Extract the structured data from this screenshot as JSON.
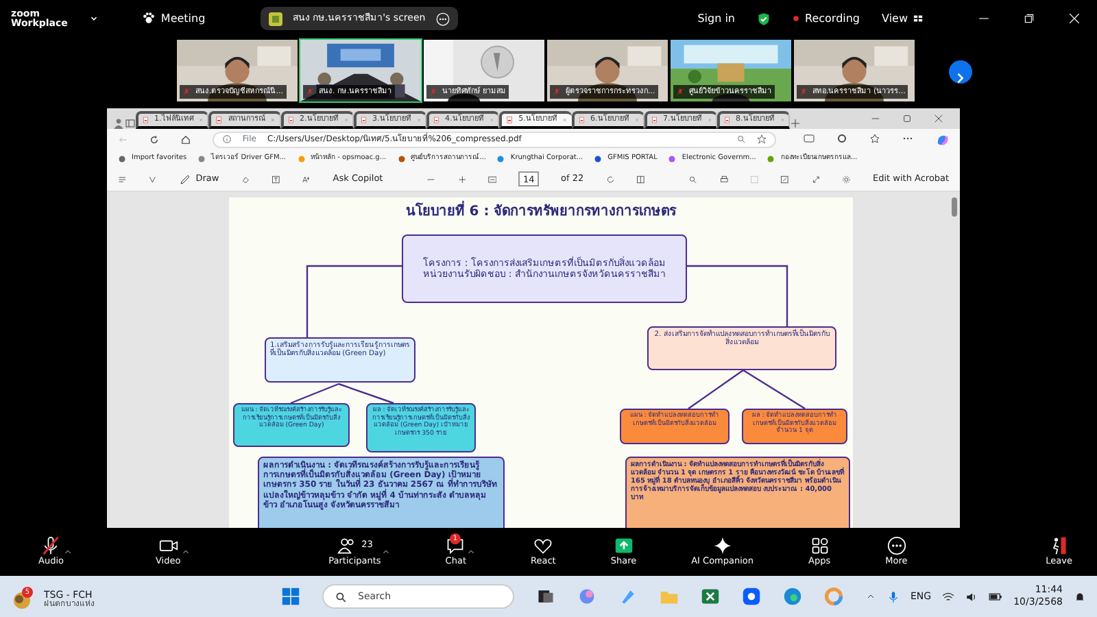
{
  "zoom": {
    "brand_top": "zoom",
    "brand_bottom": "Workplace",
    "meeting_label": "Meeting",
    "share_title": "สนง กษ.นครราชสีมา's screen",
    "sign_in": "Sign in",
    "recording": "Recording",
    "view": "View"
  },
  "participants": [
    {
      "name": "สนง.ตรวจบัญชีสหกรณ์นี...",
      "selected": false,
      "kind": "person"
    },
    {
      "name": "สนง. กษ.นครราชสีมา",
      "selected": true,
      "kind": "room"
    },
    {
      "name": "นายทิศทักษ์ ยามสม",
      "selected": false,
      "kind": "emblem"
    },
    {
      "name": "ผู้ตรวจราชการกระทรวงก...",
      "selected": false,
      "kind": "person"
    },
    {
      "name": "ศูนย์วิจัยข้าวนครราชสีมา",
      "selected": false,
      "kind": "banner"
    },
    {
      "name": "สทอ.นครราชสีมา (นาวรร...",
      "selected": false,
      "kind": "person"
    }
  ],
  "browser": {
    "tabs": [
      {
        "label": "1.ไฟล์นิเทศ",
        "selected": false
      },
      {
        "label": "สถานการณ์",
        "selected": false
      },
      {
        "label": "2.นโยบายที่",
        "selected": false
      },
      {
        "label": "3.นโยบายที่",
        "selected": false
      },
      {
        "label": "4.นโยบายที่",
        "selected": false
      },
      {
        "label": "5.นโยบายที่",
        "selected": true
      },
      {
        "label": "6.นโยบายที่",
        "selected": false
      },
      {
        "label": "7.นโยบายที่",
        "selected": false
      },
      {
        "label": "8.นโยบายที่",
        "selected": false
      }
    ],
    "address_prefix": "File",
    "url": "C:/Users/User/Desktop/นิเทศ/5.นโยบายที่%206_compressed.pdf",
    "favorites": [
      "Import favorites",
      "ไดรเวอร์ Driver GFM...",
      "หน้าหลัก - opsmoac.g...",
      "ศูนย์บริการสถานการณ์...",
      "Krungthai Corporat...",
      "GFMIS PORTAL",
      "Electronic Governm...",
      "กองทะเบียนเกษตรกรแล..."
    ],
    "pdf_toolbar": {
      "draw": "Draw",
      "ask": "Ask Copilot",
      "page": "14",
      "total": "of 22",
      "edit": "Edit with Acrobat"
    }
  },
  "document": {
    "title": "นโยบายที่ 6 : จัดการทรัพยากรทางการเกษตร",
    "header_lines": [
      "โครงการ : โครงการส่งเสริมเกษตรที่เป็นมิตรกับสิ่งแวดล้อม",
      "หน่วยงานรับผิดชอบ : สำนักงานเกษตรจังหวัดนครราชสีมา"
    ],
    "branches": [
      {
        "kind": "blue",
        "heading": "1.เสริมสร้างการรับรู้และการเรียนรู้การเกษตรที่เป็นมิตรกับสิ่งแวดล้อม (Green Day)",
        "plan": "แผน : จัดเวทีรณรงค์สร้างการรับรู้และการเรียนรู้การเกษตรที่เป็นมิตรกับสิ่งแวดล้อม (Green Day)",
        "result": "ผล : จัดเวทีรณรงค์สร้างการรับรู้และการเรียนรู้การเกษตรที่เป็นมิตรกับสิ่งแวดล้อม (Green Day) เป้าหมาย เกษตรกร 350 ราย",
        "outcome": "ผลการดำเนินงาน : จัดเวทีรณรงค์สร้างการรับรู้และการเรียนรู้การเกษตรที่เป็นมิตรกับสิ่งแวดล้อม (Green Day) เป้าหมาย เกษตรกร 350 ราย ในวันที่ 23 ธันวาคม 2567 ณ ที่ทำการบริษัทแปลงใหญ่ข้าวหลุมข้าว จำกัด หมู่ที่ 4 บ้านท่ากระสัง ตำบลหลุมข้าว อำเภอโนนสูง จังหวัดนครราชสีมา"
      },
      {
        "kind": "orange",
        "heading": "2. ส่งเสริมการจัดทำแปลงทดสอบการทำเกษตรที่เป็นมิตรกับสิ่งแวดล้อม",
        "plan": "แผน : จัดทำแปลงทดสอบการทำเกษตรที่เป็นมิตรกับสิ่งแวดล้อม",
        "result": "ผล : จัดทำแปลงทดสอบการทำเกษตรที่เป็นมิตรกับสิ่งแวดล้อม จำนวน 1 จุด",
        "outcome": "ผลการดำเนินงาน : จัดทำแปลงทดสอบการทำเกษตรที่เป็นมิตรกับสิ่งแวดล้อม จำนวน 1 จุด เกษตรกร 1 ราย คือนางทรงวัฒน์ ชะโด บ้านเลขที่ 165 หมู่ที่ 18 ตำบลหนองบุ อำเภอสีคิ้ว จังหวัดนครราชสีมา พร้อมดำเนินการจ้างเหมาบริการจัดเก็บข้อมูลแปลงทดสอบ งบประมาณ : 40,000 บาท"
      }
    ]
  },
  "toolbar": [
    {
      "kind": "audio",
      "label": "Audio",
      "muted": true
    },
    {
      "kind": "video",
      "label": "Video"
    },
    {
      "kind": "participants",
      "label": "Participants",
      "count": "23"
    },
    {
      "kind": "chat",
      "label": "Chat",
      "badge": "1"
    },
    {
      "kind": "react",
      "label": "React"
    },
    {
      "kind": "share",
      "label": "Share"
    },
    {
      "kind": "ai",
      "label": "AI Companion"
    },
    {
      "kind": "apps",
      "label": "Apps"
    },
    {
      "kind": "more",
      "label": "More"
    },
    {
      "kind": "leave",
      "label": "Leave"
    }
  ],
  "taskbar": {
    "widget_badge": "5",
    "widget_title": "TSG - FCH",
    "widget_subtitle": "ฝนตกบางแห่ง",
    "search": "Search",
    "language": "ENG",
    "time": "11:44",
    "date": "10/3/2568"
  }
}
